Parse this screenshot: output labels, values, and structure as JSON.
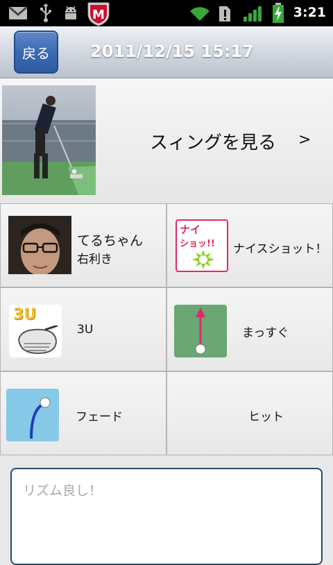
{
  "status_bar": {
    "time": "3:21",
    "icons": [
      "gmail-icon",
      "usb-icon",
      "android-debug-icon",
      "mcafee-icon",
      "wifi-icon",
      "alert-icon",
      "signal-icon",
      "battery-charging-icon"
    ],
    "mcafee_letter": "M"
  },
  "header": {
    "back_label": "戻る",
    "title": "2011/12/15 15:17"
  },
  "swing": {
    "label": "スィングを見る",
    "arrow": ">"
  },
  "grid": {
    "player_name": "てるちゃん",
    "player_hand": "右利き",
    "result_label": "ナイスショット！",
    "result_badge_line1": "ナイ",
    "result_badge_line2": "ショッ!!",
    "club_label": "3U",
    "club_badge": "3U",
    "direction_label": "まっすぐ",
    "curve_label": "フェード",
    "contact_label": "ヒット"
  },
  "comment": {
    "placeholder": "リズム良し！"
  },
  "colors": {
    "header_bg": "#c8d0d8",
    "back_button": "#3c6bb3",
    "field_green": "#6aa774",
    "fade_bg": "#87c9e8",
    "badge_pink": "#e0286a"
  }
}
